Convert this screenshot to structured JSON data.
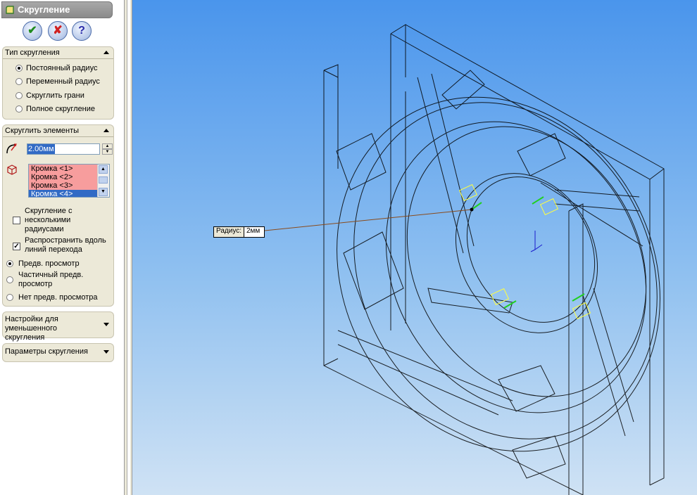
{
  "panel": {
    "title": "Скругление",
    "buttons": {
      "ok": "✔",
      "cancel": "✘",
      "help": "?"
    }
  },
  "fillet_type": {
    "header": "Тип скругления",
    "options": [
      "Постоянный радиус",
      "Переменный радиус",
      "Скруглить грани",
      "Полное скругление"
    ],
    "selected": "Постоянный радиус"
  },
  "fillet_items": {
    "header": "Скруглить элементы",
    "radius_value": "2.00мм",
    "edges": [
      "Кромка <1>",
      "Кромка <2>",
      "Кромка <3>",
      "Кромка <4>"
    ],
    "multi_radius_label": "Скругление с несколькими радиусами",
    "propagate_label": "Распространить вдоль линий перехода",
    "propagate_checked": true,
    "preview_options": [
      "Предв. просмотр",
      "Частичный предв. просмотр",
      "Нет предв. просмотра"
    ],
    "preview_selected": "Предв. просмотр"
  },
  "setback": {
    "header": "Настройки для уменьшенного скругления"
  },
  "fillet_options": {
    "header": "Параметры скругления"
  },
  "callout": {
    "label": "Радиус:",
    "value": "2мм"
  },
  "colors": {
    "accent": "#316ac5",
    "edge_highlight": "#f79d9d",
    "panel_bg": "#ece9d8"
  },
  "icons": [
    "fillet-feature-icon",
    "radius-icon",
    "edge-selection-icon",
    "ok-icon",
    "cancel-icon",
    "help-icon"
  ]
}
